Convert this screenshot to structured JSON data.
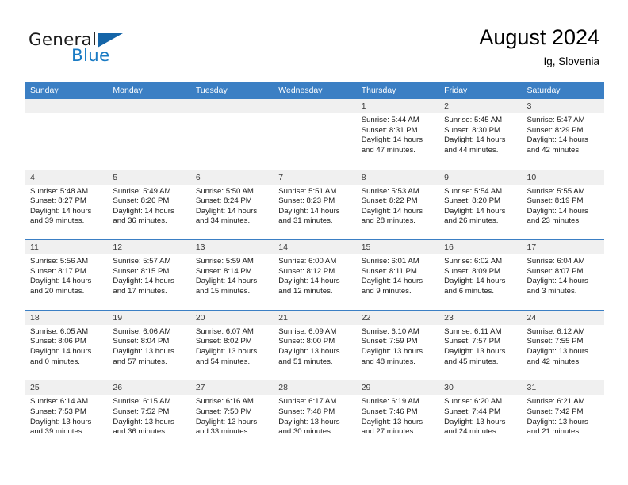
{
  "brand": {
    "name_primary": "General",
    "name_secondary": "Blue",
    "flag_icon": "triangle-flag-icon",
    "accent_color": "#1a7bc4"
  },
  "header": {
    "title": "August 2024",
    "subtitle": "Ig, Slovenia"
  },
  "theme": {
    "header_row_bg": "#3b7fc4",
    "day_header_bg": "#f0f0f0",
    "grid_line": "#3b7fc4",
    "text": "#1a1a1a"
  },
  "calendar": {
    "weekday_headers": [
      "Sunday",
      "Monday",
      "Tuesday",
      "Wednesday",
      "Thursday",
      "Friday",
      "Saturday"
    ],
    "weeks": [
      [
        {
          "date": "",
          "empty": true,
          "lines": []
        },
        {
          "date": "",
          "empty": true,
          "lines": []
        },
        {
          "date": "",
          "empty": true,
          "lines": []
        },
        {
          "date": "",
          "empty": true,
          "lines": []
        },
        {
          "date": "1",
          "empty": false,
          "lines": [
            "Sunrise: 5:44 AM",
            "Sunset: 8:31 PM",
            "Daylight: 14 hours",
            "and 47 minutes."
          ]
        },
        {
          "date": "2",
          "empty": false,
          "lines": [
            "Sunrise: 5:45 AM",
            "Sunset: 8:30 PM",
            "Daylight: 14 hours",
            "and 44 minutes."
          ]
        },
        {
          "date": "3",
          "empty": false,
          "lines": [
            "Sunrise: 5:47 AM",
            "Sunset: 8:29 PM",
            "Daylight: 14 hours",
            "and 42 minutes."
          ]
        }
      ],
      [
        {
          "date": "4",
          "empty": false,
          "lines": [
            "Sunrise: 5:48 AM",
            "Sunset: 8:27 PM",
            "Daylight: 14 hours",
            "and 39 minutes."
          ]
        },
        {
          "date": "5",
          "empty": false,
          "lines": [
            "Sunrise: 5:49 AM",
            "Sunset: 8:26 PM",
            "Daylight: 14 hours",
            "and 36 minutes."
          ]
        },
        {
          "date": "6",
          "empty": false,
          "lines": [
            "Sunrise: 5:50 AM",
            "Sunset: 8:24 PM",
            "Daylight: 14 hours",
            "and 34 minutes."
          ]
        },
        {
          "date": "7",
          "empty": false,
          "lines": [
            "Sunrise: 5:51 AM",
            "Sunset: 8:23 PM",
            "Daylight: 14 hours",
            "and 31 minutes."
          ]
        },
        {
          "date": "8",
          "empty": false,
          "lines": [
            "Sunrise: 5:53 AM",
            "Sunset: 8:22 PM",
            "Daylight: 14 hours",
            "and 28 minutes."
          ]
        },
        {
          "date": "9",
          "empty": false,
          "lines": [
            "Sunrise: 5:54 AM",
            "Sunset: 8:20 PM",
            "Daylight: 14 hours",
            "and 26 minutes."
          ]
        },
        {
          "date": "10",
          "empty": false,
          "lines": [
            "Sunrise: 5:55 AM",
            "Sunset: 8:19 PM",
            "Daylight: 14 hours",
            "and 23 minutes."
          ]
        }
      ],
      [
        {
          "date": "11",
          "empty": false,
          "lines": [
            "Sunrise: 5:56 AM",
            "Sunset: 8:17 PM",
            "Daylight: 14 hours",
            "and 20 minutes."
          ]
        },
        {
          "date": "12",
          "empty": false,
          "lines": [
            "Sunrise: 5:57 AM",
            "Sunset: 8:15 PM",
            "Daylight: 14 hours",
            "and 17 minutes."
          ]
        },
        {
          "date": "13",
          "empty": false,
          "lines": [
            "Sunrise: 5:59 AM",
            "Sunset: 8:14 PM",
            "Daylight: 14 hours",
            "and 15 minutes."
          ]
        },
        {
          "date": "14",
          "empty": false,
          "lines": [
            "Sunrise: 6:00 AM",
            "Sunset: 8:12 PM",
            "Daylight: 14 hours",
            "and 12 minutes."
          ]
        },
        {
          "date": "15",
          "empty": false,
          "lines": [
            "Sunrise: 6:01 AM",
            "Sunset: 8:11 PM",
            "Daylight: 14 hours",
            "and 9 minutes."
          ]
        },
        {
          "date": "16",
          "empty": false,
          "lines": [
            "Sunrise: 6:02 AM",
            "Sunset: 8:09 PM",
            "Daylight: 14 hours",
            "and 6 minutes."
          ]
        },
        {
          "date": "17",
          "empty": false,
          "lines": [
            "Sunrise: 6:04 AM",
            "Sunset: 8:07 PM",
            "Daylight: 14 hours",
            "and 3 minutes."
          ]
        }
      ],
      [
        {
          "date": "18",
          "empty": false,
          "lines": [
            "Sunrise: 6:05 AM",
            "Sunset: 8:06 PM",
            "Daylight: 14 hours",
            "and 0 minutes."
          ]
        },
        {
          "date": "19",
          "empty": false,
          "lines": [
            "Sunrise: 6:06 AM",
            "Sunset: 8:04 PM",
            "Daylight: 13 hours",
            "and 57 minutes."
          ]
        },
        {
          "date": "20",
          "empty": false,
          "lines": [
            "Sunrise: 6:07 AM",
            "Sunset: 8:02 PM",
            "Daylight: 13 hours",
            "and 54 minutes."
          ]
        },
        {
          "date": "21",
          "empty": false,
          "lines": [
            "Sunrise: 6:09 AM",
            "Sunset: 8:00 PM",
            "Daylight: 13 hours",
            "and 51 minutes."
          ]
        },
        {
          "date": "22",
          "empty": false,
          "lines": [
            "Sunrise: 6:10 AM",
            "Sunset: 7:59 PM",
            "Daylight: 13 hours",
            "and 48 minutes."
          ]
        },
        {
          "date": "23",
          "empty": false,
          "lines": [
            "Sunrise: 6:11 AM",
            "Sunset: 7:57 PM",
            "Daylight: 13 hours",
            "and 45 minutes."
          ]
        },
        {
          "date": "24",
          "empty": false,
          "lines": [
            "Sunrise: 6:12 AM",
            "Sunset: 7:55 PM",
            "Daylight: 13 hours",
            "and 42 minutes."
          ]
        }
      ],
      [
        {
          "date": "25",
          "empty": false,
          "lines": [
            "Sunrise: 6:14 AM",
            "Sunset: 7:53 PM",
            "Daylight: 13 hours",
            "and 39 minutes."
          ]
        },
        {
          "date": "26",
          "empty": false,
          "lines": [
            "Sunrise: 6:15 AM",
            "Sunset: 7:52 PM",
            "Daylight: 13 hours",
            "and 36 minutes."
          ]
        },
        {
          "date": "27",
          "empty": false,
          "lines": [
            "Sunrise: 6:16 AM",
            "Sunset: 7:50 PM",
            "Daylight: 13 hours",
            "and 33 minutes."
          ]
        },
        {
          "date": "28",
          "empty": false,
          "lines": [
            "Sunrise: 6:17 AM",
            "Sunset: 7:48 PM",
            "Daylight: 13 hours",
            "and 30 minutes."
          ]
        },
        {
          "date": "29",
          "empty": false,
          "lines": [
            "Sunrise: 6:19 AM",
            "Sunset: 7:46 PM",
            "Daylight: 13 hours",
            "and 27 minutes."
          ]
        },
        {
          "date": "30",
          "empty": false,
          "lines": [
            "Sunrise: 6:20 AM",
            "Sunset: 7:44 PM",
            "Daylight: 13 hours",
            "and 24 minutes."
          ]
        },
        {
          "date": "31",
          "empty": false,
          "lines": [
            "Sunrise: 6:21 AM",
            "Sunset: 7:42 PM",
            "Daylight: 13 hours",
            "and 21 minutes."
          ]
        }
      ]
    ]
  }
}
